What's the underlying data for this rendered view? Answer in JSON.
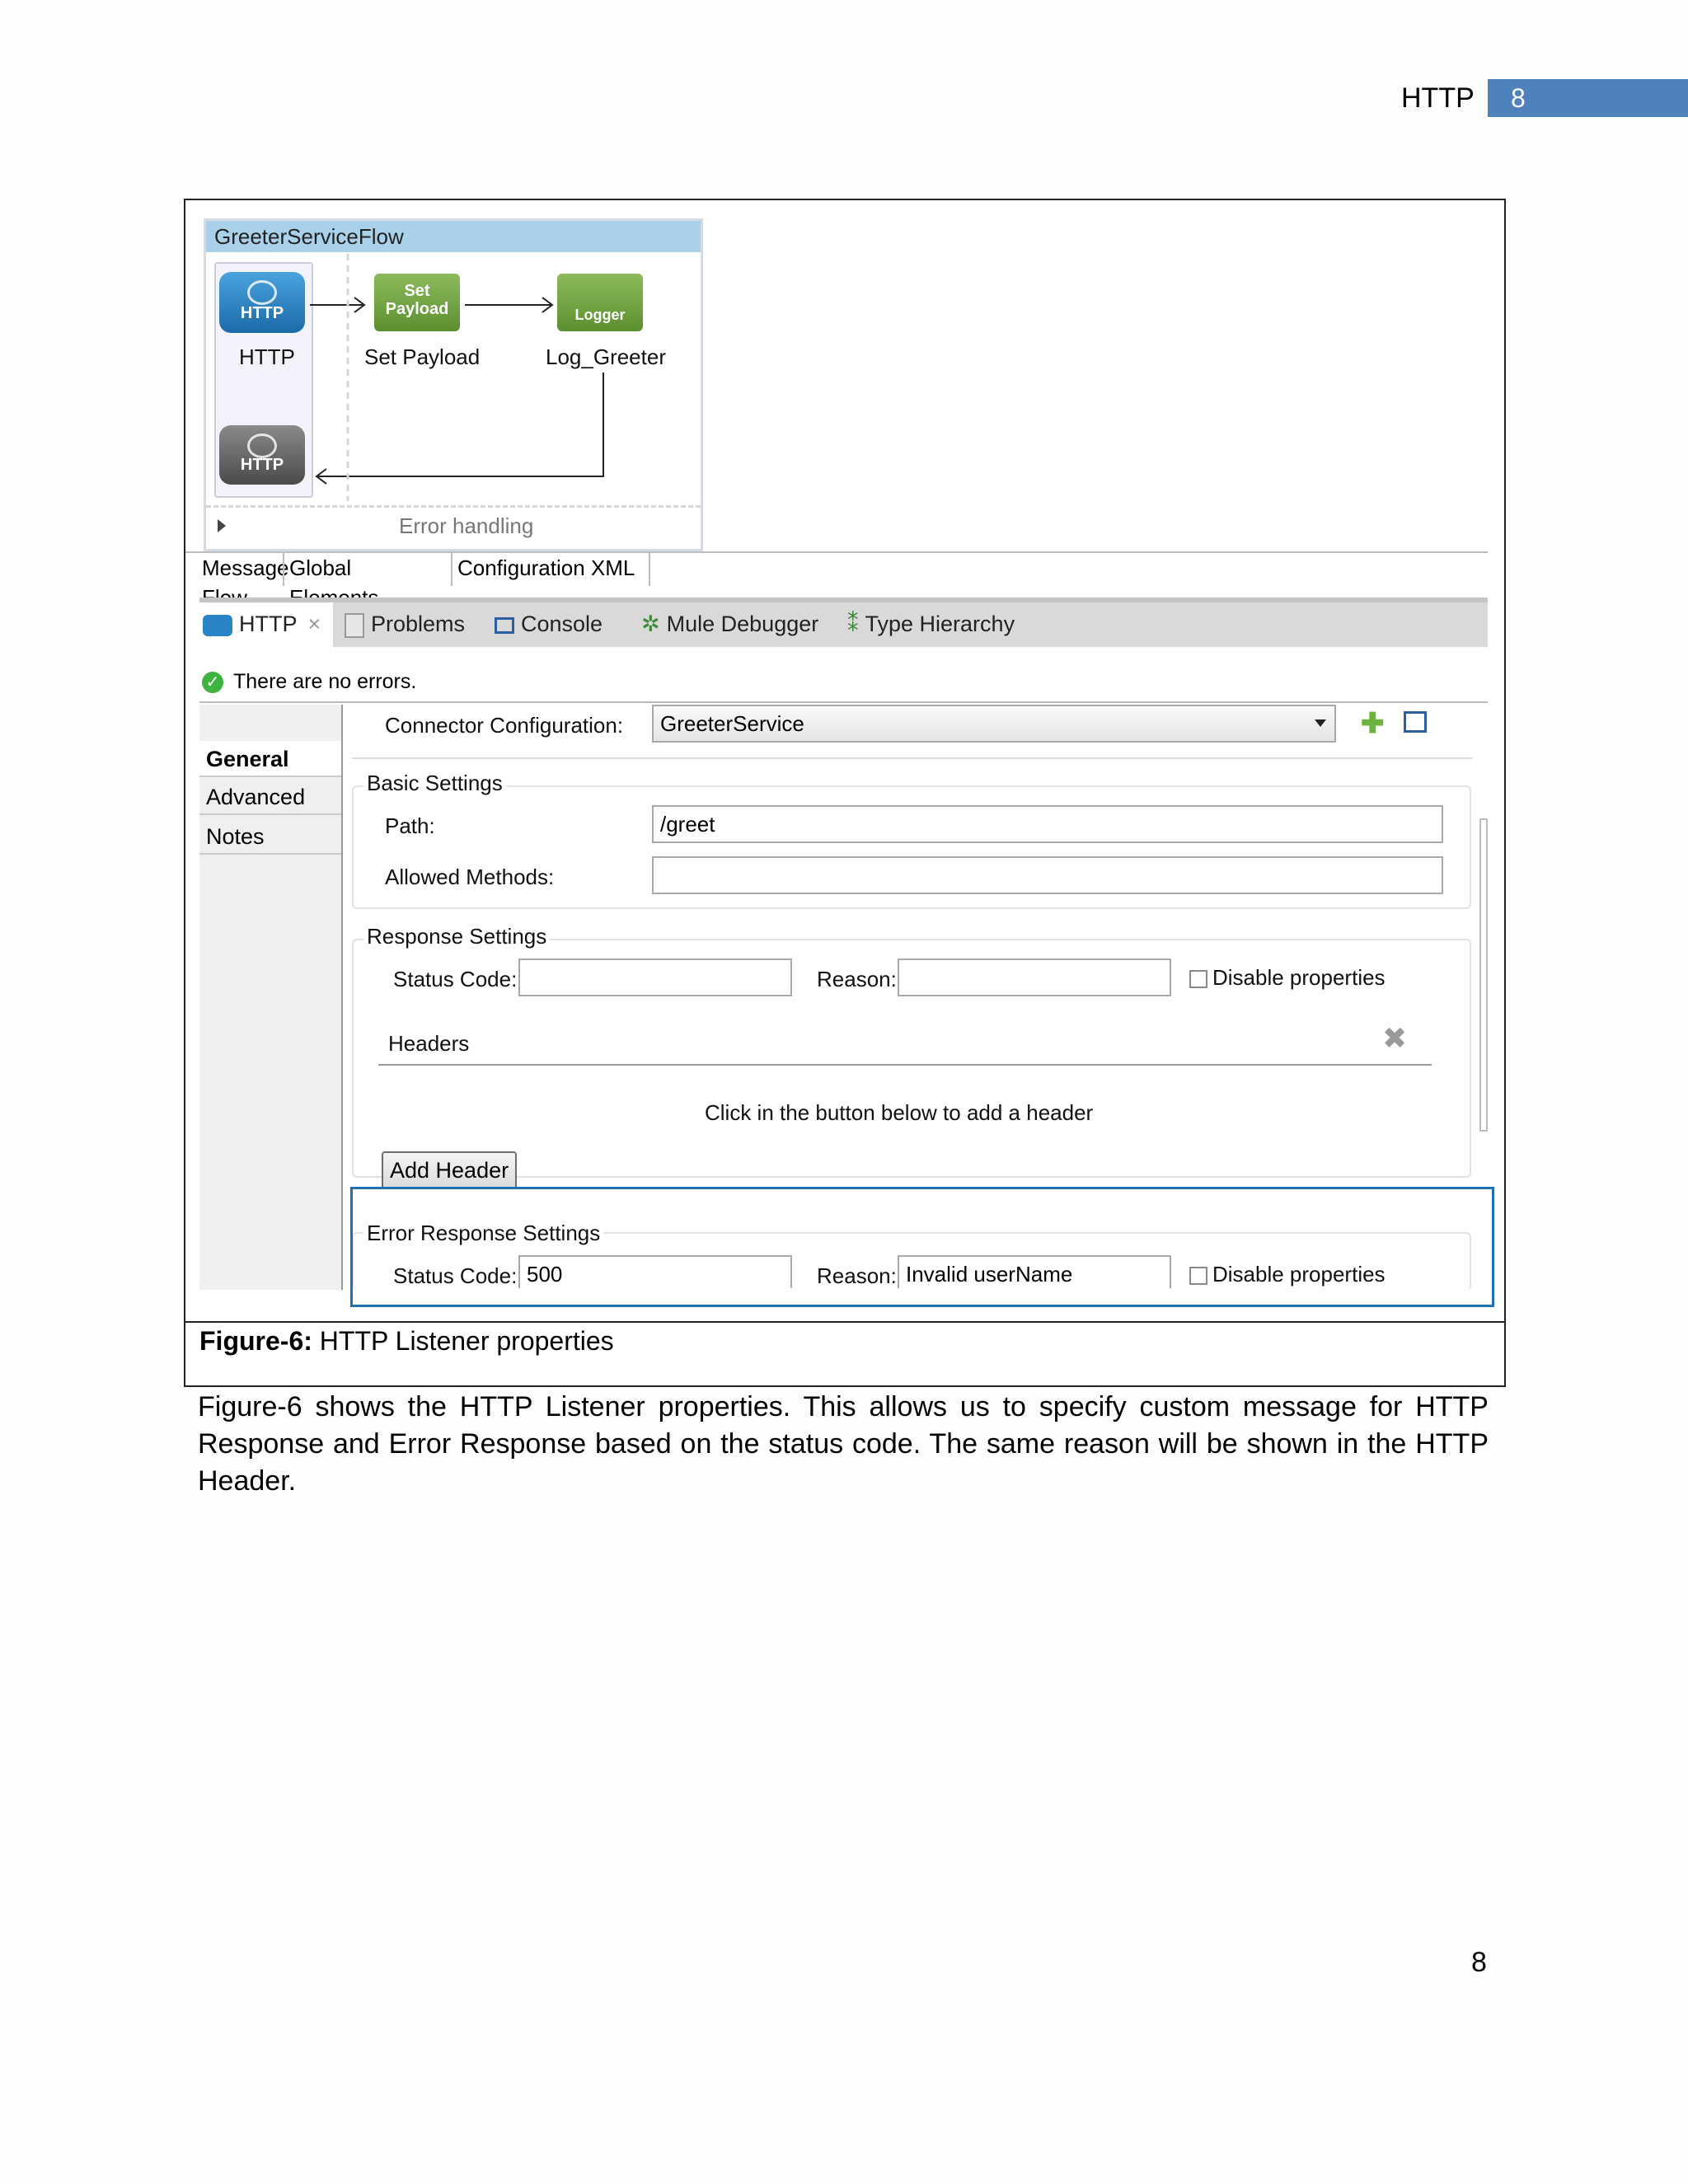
{
  "header": {
    "title": "HTTP",
    "page_badge": "8"
  },
  "figure": {
    "flow": {
      "title": "GreeterServiceFlow",
      "nodes": [
        {
          "icon_text": "HTTP",
          "label": "HTTP"
        },
        {
          "icon_text_1": "Set",
          "icon_text_2": "Payload",
          "label": "Set Payload"
        },
        {
          "icon_text": "Logger",
          "label": "Log_Greeter"
        }
      ],
      "response_icon_text": "HTTP",
      "error_handling": "Error handling"
    },
    "editor_tabs": [
      "Message Flow",
      "Global Elements",
      "Configuration XML"
    ],
    "view_tabs": [
      "HTTP",
      "Problems",
      "Console",
      "Mule Debugger",
      "Type Hierarchy"
    ],
    "status": "There are no errors.",
    "side_nav": [
      "General",
      "Advanced",
      "Notes"
    ],
    "connector_label": "Connector Configuration:",
    "connector_value": "GreeterService",
    "basic_settings": {
      "title": "Basic Settings",
      "path_label": "Path:",
      "path_value": "/greet",
      "methods_label": "Allowed Methods:",
      "methods_value": ""
    },
    "response_settings": {
      "title": "Response Settings",
      "status_label": "Status Code:",
      "status_value": "",
      "reason_label": "Reason:",
      "reason_value": "",
      "disable_label": "Disable properties",
      "headers_label": "Headers",
      "headers_hint": "Click in the button below to add a header",
      "add_header": "Add Header"
    },
    "error_response_settings": {
      "title": "Error Response Settings",
      "status_label": "Status Code:",
      "status_value": "500",
      "reason_label": "Reason:",
      "reason_value": "Invalid userName",
      "disable_label": "Disable properties"
    },
    "caption_bold": "Figure-6:",
    "caption_text": " HTTP Listener properties"
  },
  "body_text": "Figure-6 shows the HTTP Listener properties.  This allows us to specify custom message for HTTP Response and Error Response based on the status code. The same reason will be shown in the HTTP Header.",
  "page_number": "8",
  "colors": {
    "accent": "#4f81bd",
    "highlight_border": "#1f6fb3",
    "flow_title_bg": "#a9d1ea"
  }
}
